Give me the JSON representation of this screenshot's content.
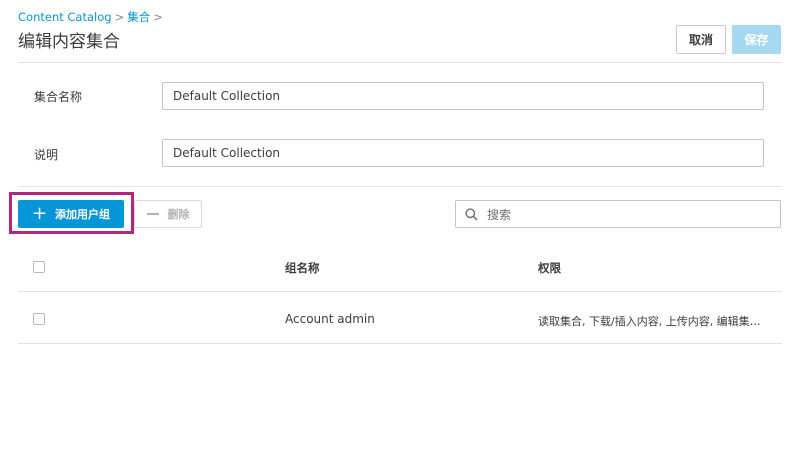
{
  "breadcrumb": {
    "root": "Content Catalog",
    "current": "集合",
    "separator": ">"
  },
  "page": {
    "title": "编辑内容集合"
  },
  "header_actions": {
    "cancel_label": "取消",
    "save_label": "保存"
  },
  "form": {
    "name_label": "集合名称",
    "name_value": "Default Collection",
    "description_label": "说明",
    "description_value": "Default Collection"
  },
  "toolbar": {
    "add_label": "添加用户组",
    "delete_label": "删除",
    "search_placeholder": "搜索"
  },
  "table": {
    "columns": {
      "name": "组名称",
      "permissions": "权限"
    },
    "rows": [
      {
        "name": "Account admin",
        "permissions": "读取集合, 下载/插入内容, 上传内容, 编辑集…"
      }
    ]
  },
  "colors": {
    "accent": "#0696d7",
    "save_disabled": "#a6d8f2",
    "highlight": "#b0287a"
  },
  "icons": {
    "add": "plus-icon",
    "delete": "minus-icon",
    "search": "search-icon"
  }
}
